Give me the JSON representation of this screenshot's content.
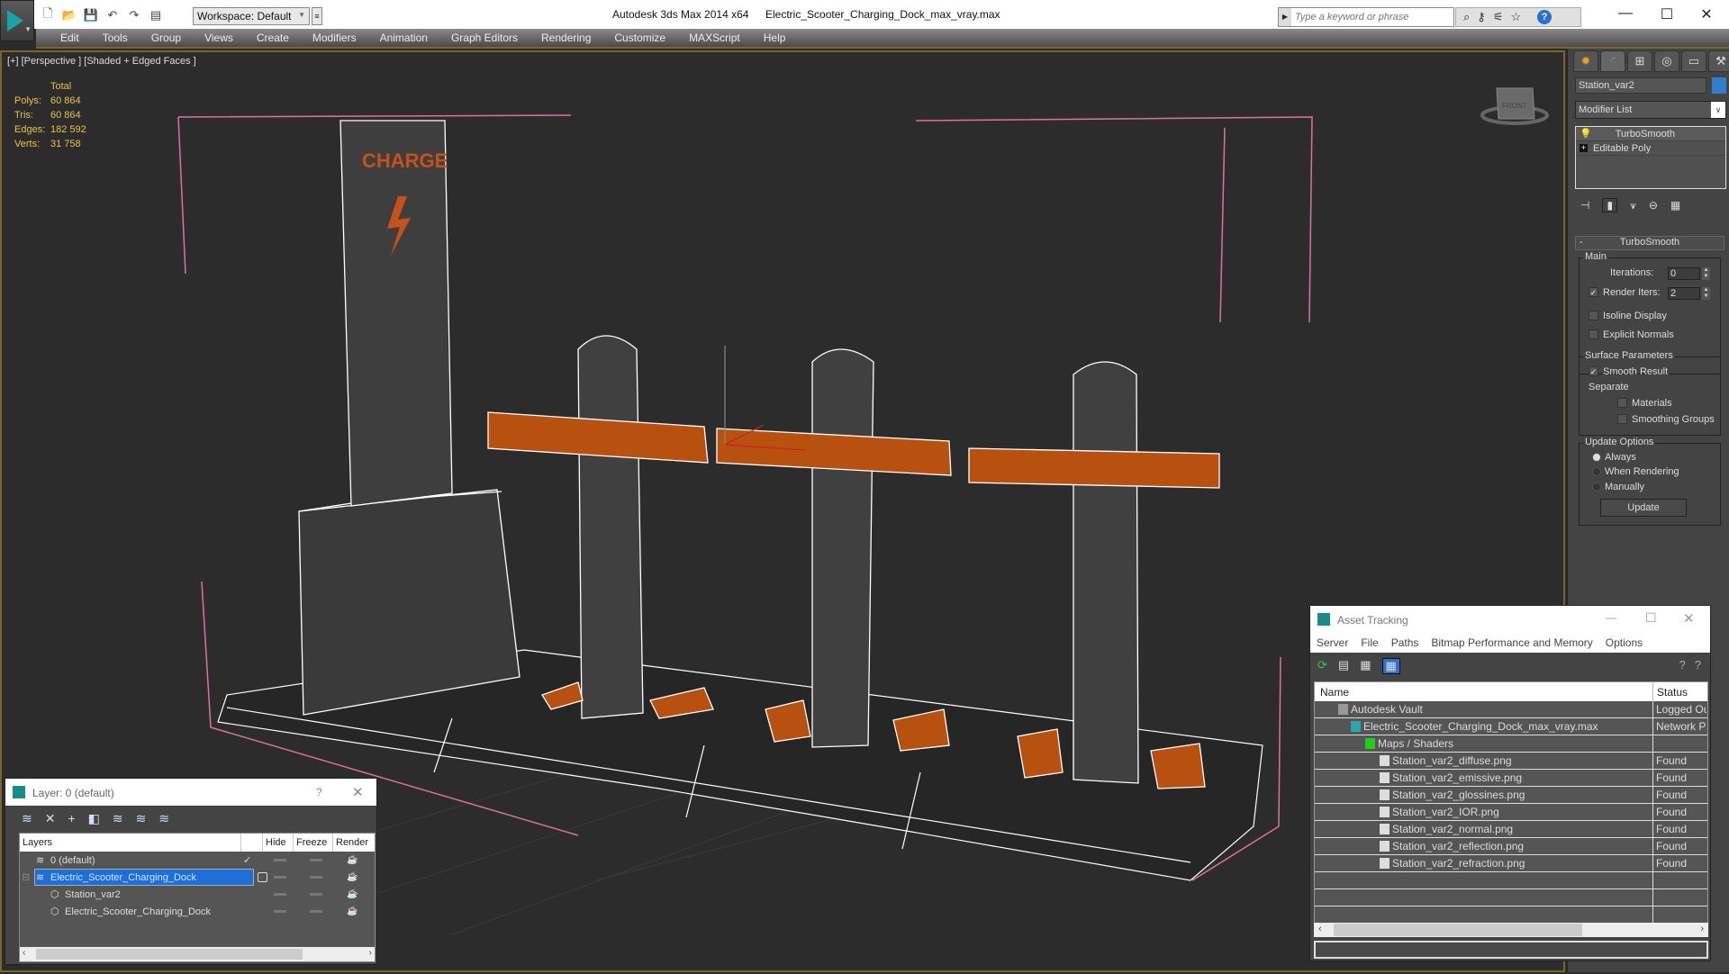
{
  "titlebar": {
    "app_title": "Autodesk 3ds Max  2014 x64",
    "file_title": "Electric_Scooter_Charging_Dock_max_vray.max",
    "workspace": "Workspace: Default",
    "search_placeholder": "Type a keyword or phrase"
  },
  "menu": [
    "Edit",
    "Tools",
    "Group",
    "Views",
    "Create",
    "Modifiers",
    "Animation",
    "Graph Editors",
    "Rendering",
    "Customize",
    "MAXScript",
    "Help"
  ],
  "viewport": {
    "label": "[+] [Perspective ] [Shaded + Edged Faces ]",
    "stats": {
      "header": "Total",
      "rows": [
        {
          "key": "Polys:",
          "value": "60 864"
        },
        {
          "key": "Tris:",
          "value": "60 864"
        },
        {
          "key": "Edges:",
          "value": "182 592"
        },
        {
          "key": "Verts:",
          "value": "31 758"
        }
      ]
    },
    "sign_text": "CHARGE",
    "viewcube_label": "FRONT"
  },
  "command_panel": {
    "object_name": "Station_var2",
    "object_color": "#2f7fcf",
    "modifier_list": "Modifier List",
    "stack": [
      "TurboSmooth",
      "Editable Poly"
    ],
    "rollout_title": "TurboSmooth",
    "main_group": "Main",
    "iterations_label": "Iterations:",
    "iterations_value": "0",
    "render_iters_label": "Render Iters:",
    "render_iters_value": "2",
    "render_iters_checked": true,
    "isoline_label": "Isoline Display",
    "explicit_normals_label": "Explicit Normals",
    "surface_group": "Surface Parameters",
    "smooth_result_label": "Smooth Result",
    "separate_label": "Separate",
    "materials_label": "Materials",
    "smoothing_groups_label": "Smoothing Groups",
    "update_group": "Update Options",
    "update_options": [
      "Always",
      "When Rendering",
      "Manually"
    ],
    "update_selected": "Always",
    "update_button": "Update"
  },
  "layer_window": {
    "title": "Layer: 0 (default)",
    "help": "?",
    "columns": [
      "Layers",
      "",
      "Hide",
      "Freeze",
      "Render"
    ],
    "rows": [
      {
        "name": "0 (default)",
        "active": true
      },
      {
        "name": "Electric_Scooter_Charging_Dock",
        "selected": true
      },
      {
        "name": "Station_var2"
      },
      {
        "name": "Electric_Scooter_Charging_Dock"
      }
    ]
  },
  "asset_window": {
    "title": "Asset Tracking",
    "menu": [
      "Server",
      "File",
      "Paths",
      "Bitmap Performance and Memory",
      "Options"
    ],
    "columns": [
      "Name",
      "Status"
    ],
    "rows": [
      {
        "name": "Autodesk Vault",
        "status": "Logged Ou"
      },
      {
        "name": "Electric_Scooter_Charging_Dock_max_vray.max",
        "status": "Network Pa"
      },
      {
        "name": "Maps / Shaders",
        "status": ""
      },
      {
        "name": "Station_var2_diffuse.png",
        "status": "Found"
      },
      {
        "name": "Station_var2_emissive.png",
        "status": "Found"
      },
      {
        "name": "Station_var2_glossines.png",
        "status": "Found"
      },
      {
        "name": "Station_var2_IOR.png",
        "status": "Found"
      },
      {
        "name": "Station_var2_normal.png",
        "status": "Found"
      },
      {
        "name": "Station_var2_reflection.png",
        "status": "Found"
      },
      {
        "name": "Station_var2_refraction.png",
        "status": "Found"
      }
    ]
  }
}
